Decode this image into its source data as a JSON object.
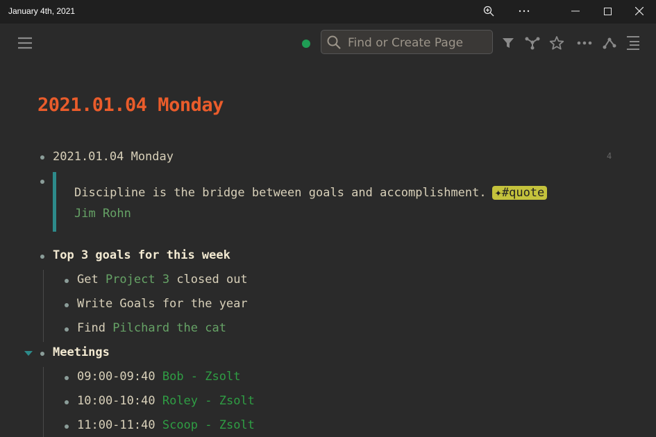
{
  "window": {
    "title": "January 4th, 2021"
  },
  "search": {
    "placeholder": "Find or Create Page"
  },
  "page": {
    "title": "2021.01.04 Monday",
    "first_block": {
      "text": "2021.01.04 Monday",
      "ref_count": "4"
    },
    "quote": {
      "text": "Discipline is the bridge between goals and accomplishment.",
      "tag": "✦#quote",
      "author": "Jim Rohn"
    },
    "goals": {
      "heading": "Top 3 goals for this week",
      "items": [
        {
          "prefix": "Get ",
          "link": "Project 3",
          "suffix": " closed out"
        },
        {
          "prefix": "Write Goals for the year",
          "link": "",
          "suffix": ""
        },
        {
          "prefix": "Find ",
          "link": "Pilchard the cat",
          "suffix": ""
        }
      ]
    },
    "meetings": {
      "heading": "Meetings",
      "items": [
        {
          "time": "09:00-09:40",
          "link": "Bob - Zsolt"
        },
        {
          "time": "10:00-10:40",
          "link": "Roley - Zsolt"
        },
        {
          "time": "11:00-11:40",
          "link": "Scoop - Zsolt"
        }
      ]
    }
  },
  "colors": {
    "title": "#ea5c2b",
    "link": "#66a366",
    "tag_bg": "#c4c23c",
    "status": "#1f9d55"
  }
}
